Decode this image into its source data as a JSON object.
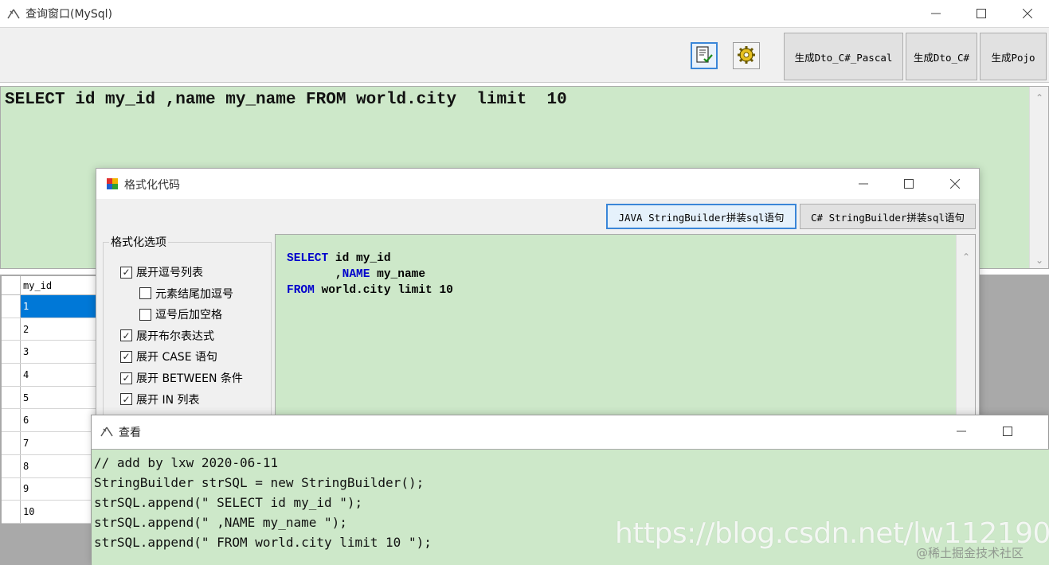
{
  "main_window": {
    "title": "查询窗口(MySql)",
    "toolbar": {
      "icon1": "document-check-icon",
      "icon2": "gear-icon",
      "btn_dto_pascal": "生成Dto_C#_Pascal",
      "btn_dto": "生成Dto_C#",
      "btn_pojo": "生成Pojo"
    },
    "sql": "SELECT id my_id ,name my_name FROM world.city  limit  10",
    "grid": {
      "column": "my_id",
      "rows": [
        "1",
        "2",
        "3",
        "4",
        "5",
        "6",
        "7",
        "8",
        "9",
        "10"
      ],
      "selected_row": "1"
    }
  },
  "format_dialog": {
    "title": "格式化代码",
    "btn_java": "JAVA StringBuilder拼装sql语句",
    "btn_csharp": "C# StringBuilder拼装sql语句",
    "options_title": "格式化选项",
    "options": [
      {
        "label": "展开逗号列表",
        "checked": true
      },
      {
        "label": "元素结尾加逗号",
        "checked": false
      },
      {
        "label": "逗号后加空格",
        "checked": false
      },
      {
        "label": "展开布尔表达式",
        "checked": true
      },
      {
        "label": "展开 CASE 语句",
        "checked": true
      },
      {
        "label": "展开 BETWEEN 条件",
        "checked": true
      },
      {
        "label": "展开 IN 列表",
        "checked": true
      }
    ],
    "code": {
      "l1_kw": "SELECT",
      "l1_rest": " id my_id",
      "l2_pre": "       ,",
      "l2_kw": "NAME",
      "l2_rest": " my_name",
      "l3_kw": "FROM",
      "l3_rest": " world.city limit 10"
    }
  },
  "view_dialog": {
    "title": "查看",
    "lines": [
      "// add by lxw 2020-06-11",
      "StringBuilder strSQL = new StringBuilder();",
      "strSQL.append(\" SELECT id my_id \");",
      "strSQL.append(\" ,NAME my_name \");",
      "strSQL.append(\" FROM world.city limit 10 \");"
    ]
  },
  "watermark": "https://blog.csdn.net/lw112190",
  "watermark_site": "@稀土掘金技术社区"
}
